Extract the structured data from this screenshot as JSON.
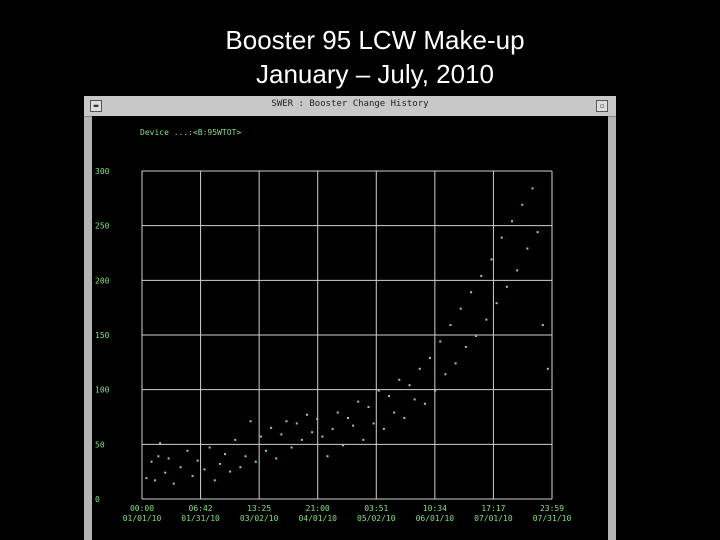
{
  "slide": {
    "title_line1": "Booster 95 LCW Make-up",
    "title_line2": "January – July, 2010"
  },
  "window": {
    "title": "SWER : Booster Change History",
    "close_icon": "close-icon",
    "maximize_icon": "maximize-icon"
  },
  "plot": {
    "device_label": "Device ...:<B:95WTOT>"
  },
  "colors": {
    "background": "#000000",
    "window_frame": "#b4b4b4",
    "text": "#7fe07f",
    "grid": "#d0d0d0",
    "data": "#7fe07f"
  },
  "chart_data": {
    "type": "scatter",
    "title": "",
    "xlabel": "",
    "ylabel": "",
    "ylim": [
      0,
      300
    ],
    "yticks": [
      "300",
      "250",
      "200",
      "150",
      "100",
      "50",
      "0"
    ],
    "xticks": [
      {
        "time": "00:00",
        "date": "01/01/10"
      },
      {
        "time": "06:42",
        "date": "01/31/10"
      },
      {
        "time": "13:25",
        "date": "03/02/10"
      },
      {
        "time": "21:00",
        "date": "04/01/10"
      },
      {
        "time": "03:51",
        "date": "05/02/10"
      },
      {
        "time": "10:34",
        "date": "06/01/10"
      },
      {
        "time": "17:17",
        "date": "07/01/10"
      },
      {
        "time": "23:59",
        "date": "07/31/10"
      }
    ],
    "grid": true,
    "series": [
      {
        "points": [
          [
            0.2,
            20
          ],
          [
            0.5,
            35
          ],
          [
            0.7,
            18
          ],
          [
            0.9,
            40
          ],
          [
            1.0,
            52
          ],
          [
            1.3,
            25
          ],
          [
            1.5,
            38
          ],
          [
            1.8,
            15
          ],
          [
            2.2,
            30
          ],
          [
            2.6,
            45
          ],
          [
            2.9,
            22
          ],
          [
            3.2,
            36
          ],
          [
            3.6,
            28
          ],
          [
            3.9,
            48
          ],
          [
            4.2,
            18
          ],
          [
            4.5,
            33
          ],
          [
            4.8,
            42
          ],
          [
            5.1,
            26
          ],
          [
            5.4,
            55
          ],
          [
            5.7,
            30
          ],
          [
            6.0,
            40
          ],
          [
            6.3,
            72
          ],
          [
            6.6,
            35
          ],
          [
            6.9,
            58
          ],
          [
            7.2,
            45
          ],
          [
            7.5,
            66
          ],
          [
            7.8,
            38
          ],
          [
            8.1,
            60
          ],
          [
            8.4,
            72
          ],
          [
            8.7,
            48
          ],
          [
            9.0,
            70
          ],
          [
            9.3,
            55
          ],
          [
            9.6,
            78
          ],
          [
            9.9,
            62
          ],
          [
            10.2,
            74
          ],
          [
            10.5,
            58
          ],
          [
            10.8,
            40
          ],
          [
            11.1,
            65
          ],
          [
            11.4,
            80
          ],
          [
            11.7,
            50
          ],
          [
            12.0,
            75
          ],
          [
            12.3,
            68
          ],
          [
            12.6,
            90
          ],
          [
            12.9,
            55
          ],
          [
            13.2,
            85
          ],
          [
            13.5,
            70
          ],
          [
            13.8,
            100
          ],
          [
            14.1,
            65
          ],
          [
            14.4,
            95
          ],
          [
            14.7,
            80
          ],
          [
            15.0,
            110
          ],
          [
            15.3,
            75
          ],
          [
            15.6,
            105
          ],
          [
            15.9,
            92
          ],
          [
            16.2,
            120
          ],
          [
            16.5,
            88
          ],
          [
            16.8,
            130
          ],
          [
            17.1,
            100
          ],
          [
            17.4,
            145
          ],
          [
            17.7,
            115
          ],
          [
            18.0,
            160
          ],
          [
            18.3,
            125
          ],
          [
            18.6,
            175
          ],
          [
            18.9,
            140
          ],
          [
            19.2,
            190
          ],
          [
            19.5,
            150
          ],
          [
            19.8,
            205
          ],
          [
            20.1,
            165
          ],
          [
            20.4,
            220
          ],
          [
            20.7,
            180
          ],
          [
            21.0,
            240
          ],
          [
            21.3,
            195
          ],
          [
            21.6,
            255
          ],
          [
            21.9,
            210
          ],
          [
            22.2,
            270
          ],
          [
            22.5,
            230
          ],
          [
            22.8,
            285
          ],
          [
            23.1,
            245
          ],
          [
            23.4,
            160
          ],
          [
            23.7,
            120
          ]
        ]
      }
    ]
  }
}
